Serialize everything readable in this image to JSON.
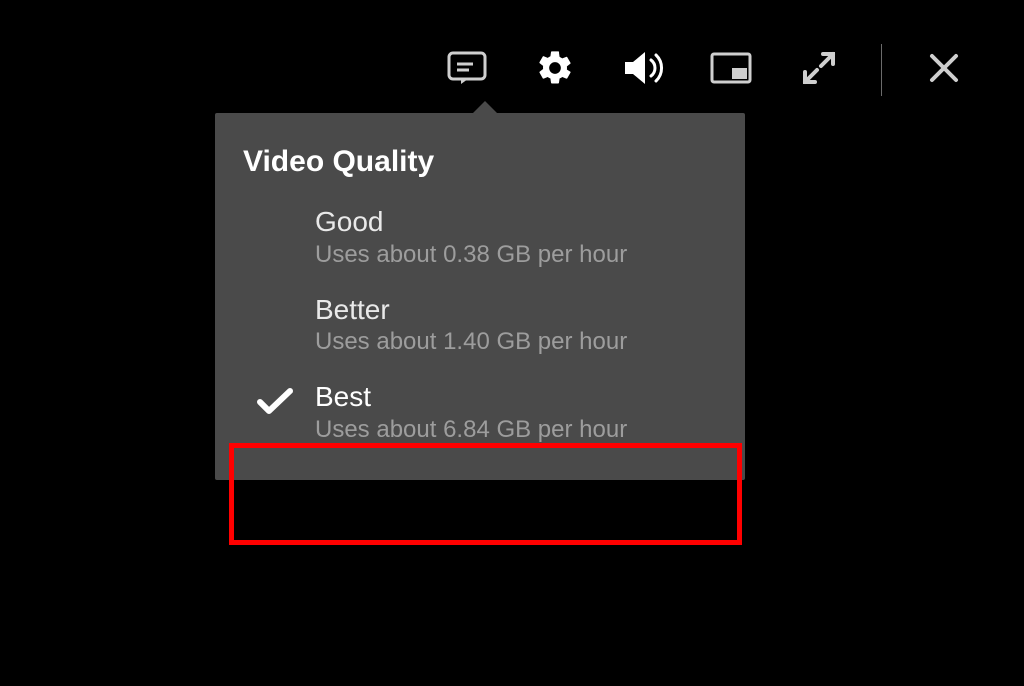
{
  "controls": {
    "subtitles_icon": "subtitles",
    "settings_icon": "settings",
    "volume_icon": "volume",
    "pip_icon": "picture-in-picture",
    "fullscreen_icon": "fullscreen",
    "close_icon": "close"
  },
  "settings_panel": {
    "title": "Video Quality",
    "options": [
      {
        "label": "Good",
        "sub": "Uses about 0.38 GB per hour",
        "selected": false
      },
      {
        "label": "Better",
        "sub": "Uses about 1.40 GB per hour",
        "selected": false
      },
      {
        "label": "Best",
        "sub": "Uses about 6.84 GB per hour",
        "selected": true
      }
    ]
  },
  "annotation": {
    "highlight_color": "#ff0000",
    "highlights_option_index": 2
  }
}
